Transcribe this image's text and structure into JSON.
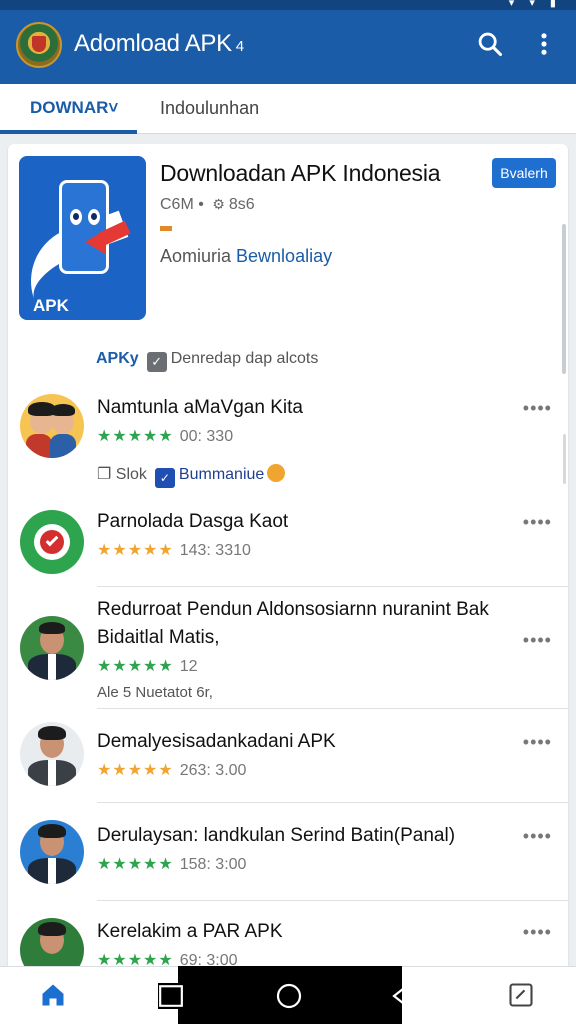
{
  "app": {
    "title": "Adomload APK",
    "title_suffix": " 4"
  },
  "tabs": [
    {
      "label": "DOWNAR˅",
      "active": true
    },
    {
      "label": "Indoulunhan",
      "active": false
    }
  ],
  "featured": {
    "title": "Downloadan APK Indonesia",
    "install_label": "Bvalerh",
    "meta_left": "C6M",
    "meta_dot": "•",
    "meta_right": "8s6",
    "subtitle_plain": "Aomiuria ",
    "subtitle_link": "Bewnloaliay",
    "icon_label": "APK"
  },
  "section": {
    "apky": "APKy",
    "text": "Denredap dap alcots"
  },
  "items": [
    {
      "title": "Namtunla aMaVgan Kita",
      "stars": "★★★★★",
      "rating_text": "00: 330",
      "star_color": "#2ea44f",
      "extra_icon": "❐",
      "extra_a": "Slok",
      "extra_badge": "✓",
      "extra_b": "Bummaniue"
    },
    {
      "title": "Parnolada Dasga Kaot",
      "stars": "★★★★★",
      "rating_text": "143: 3310",
      "star_color": "#f0a531"
    },
    {
      "title_line1": "Redurroat Pendun Aldonsosiarnn nuranint Bak",
      "title_line2": "Bidaitlal Matis,",
      "stars": "★★★★★",
      "rating_text": "12",
      "star_color": "#2ea44f",
      "extra": "Ale 5 Nuetatot 6r,"
    },
    {
      "title": "Demalyesisadankadani APK",
      "stars": "★★★★★",
      "rating_text": "263: 3.00",
      "star_color": "#f0a531"
    },
    {
      "title": "Derulaysan: landkulan Serind Batin(Panal)",
      "stars": "★★★★★",
      "rating_text": "158: 3:00",
      "star_color": "#2ea44f"
    },
    {
      "title": "Kerelakim a PAR APK",
      "stars": "★★★★★",
      "rating_text": "69: 3:00",
      "star_color": "#2ea44f"
    }
  ],
  "dots": "••••",
  "icons": {
    "search": "search-icon",
    "more": "more-vert-icon",
    "home": "home-icon",
    "circle": "circle-home-icon",
    "back": "back-icon",
    "recent": "recent-icon"
  },
  "colors": {
    "primary": "#1b5ca8",
    "star_green": "#2ea44f",
    "star_orange": "#f0a531"
  }
}
